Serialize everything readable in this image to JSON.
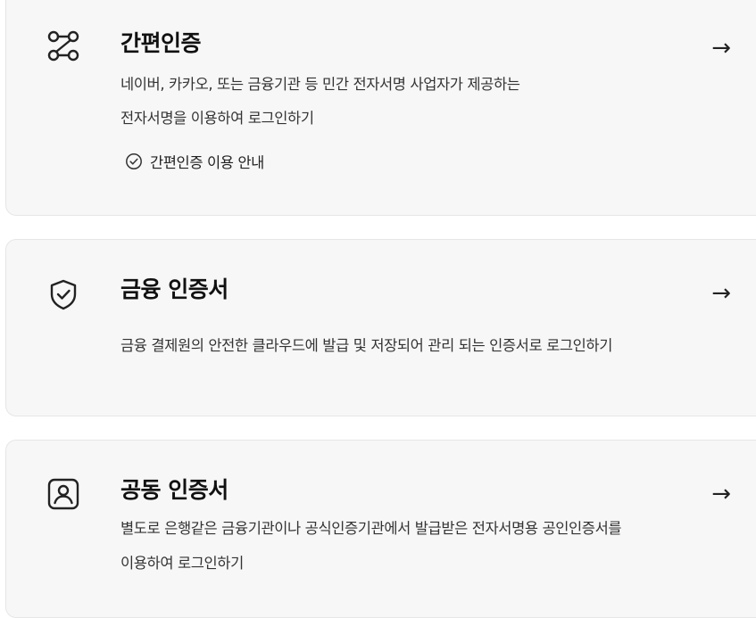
{
  "cards": [
    {
      "title": "간편인증",
      "desc_lines": [
        "네이버, 카카오, 또는 금융기관 등 민간 전자서명 사업자가 제공하는",
        "전자서명을 이용하여 로그인하기"
      ],
      "guide_label": "간편인증 이용 안내",
      "icon": "route-icon",
      "arrow": "→"
    },
    {
      "title": "금융 인증서",
      "desc_lines": [
        "금융 결제원의 안전한 클라우드에 발급 및 저장되어 관리 되는 인증서로 로그인하기"
      ],
      "icon": "shield-check-icon",
      "arrow": "→"
    },
    {
      "title": "공동 인증서",
      "desc_lines": [
        "별도로 은행같은 금융기관이나 공식인증기관에서 발급받은 전자서명용 공인인증서를",
        "이용하여 로그인하기"
      ],
      "icon": "user-badge-icon",
      "arrow": "→"
    }
  ],
  "colors": {
    "card_bg": "#f7f7f7",
    "card_border": "#e6e6e6",
    "text_primary": "#111111",
    "text_secondary": "#333333"
  }
}
